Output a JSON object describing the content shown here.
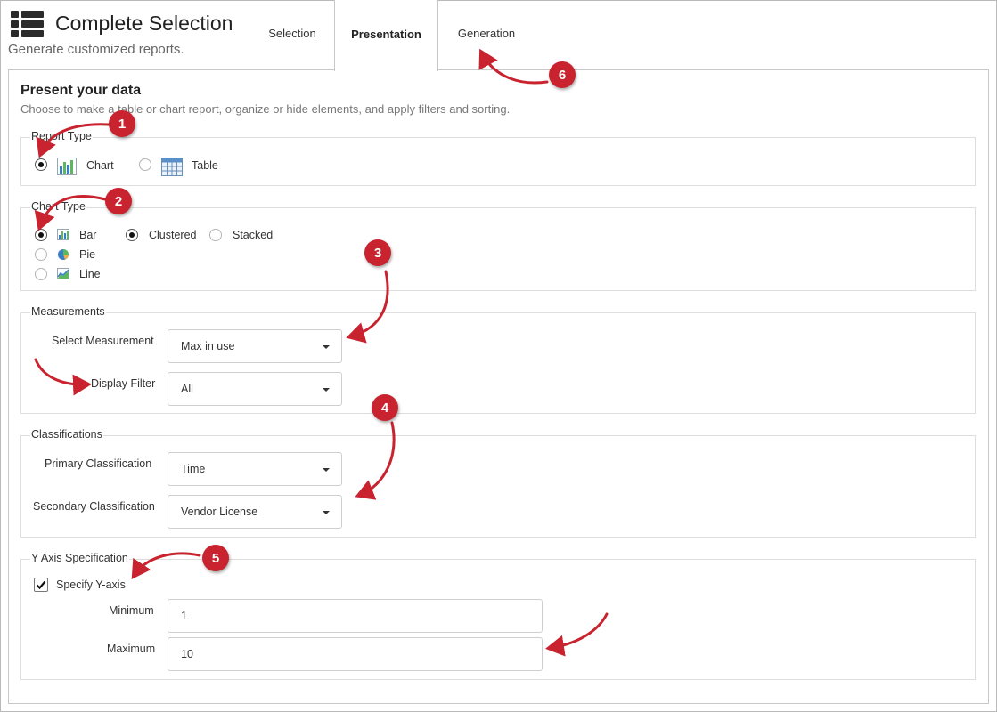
{
  "header": {
    "title": "Complete Selection",
    "subtitle": "Generate customized reports.",
    "icon": "table-list-icon"
  },
  "tabs": [
    {
      "label": "Selection",
      "active": false
    },
    {
      "label": "Presentation",
      "active": true
    },
    {
      "label": "Generation",
      "active": false
    }
  ],
  "panel": {
    "title": "Present your data",
    "description": "Choose to make a table or chart report, organize or hide elements, and apply filters and sorting."
  },
  "report_type": {
    "legend": "Report Type",
    "options": [
      {
        "label": "Chart",
        "selected": true,
        "icon": "bar-chart-icon"
      },
      {
        "label": "Table",
        "selected": false,
        "icon": "table-grid-icon"
      }
    ]
  },
  "chart_type": {
    "legend": "Chart Type",
    "options": [
      {
        "label": "Bar",
        "selected": true,
        "icon": "bar-chart-icon"
      },
      {
        "label": "Pie",
        "selected": false,
        "icon": "pie-chart-icon"
      },
      {
        "label": "Line",
        "selected": false,
        "icon": "line-chart-icon"
      }
    ],
    "bar_modes": [
      {
        "label": "Clustered",
        "selected": true
      },
      {
        "label": "Stacked",
        "selected": false
      }
    ]
  },
  "measurements": {
    "legend": "Measurements",
    "select_measurement_label": "Select Measurement",
    "select_measurement_value": "Max in use",
    "display_filter_label": "Display Filter",
    "display_filter_value": "All"
  },
  "classifications": {
    "legend": "Classifications",
    "primary_label": "Primary Classification",
    "primary_value": "Time",
    "secondary_label": "Secondary Classification",
    "secondary_value": "Vendor License"
  },
  "y_axis": {
    "legend": "Y Axis Specification",
    "specify_label": "Specify Y-axis",
    "specify_checked": true,
    "minimum_label": "Minimum",
    "minimum_value": "1",
    "maximum_label": "Maximum",
    "maximum_value": "10"
  },
  "annotations": {
    "badges": [
      "1",
      "2",
      "3",
      "4",
      "5",
      "6"
    ],
    "color": "#c8232f"
  }
}
